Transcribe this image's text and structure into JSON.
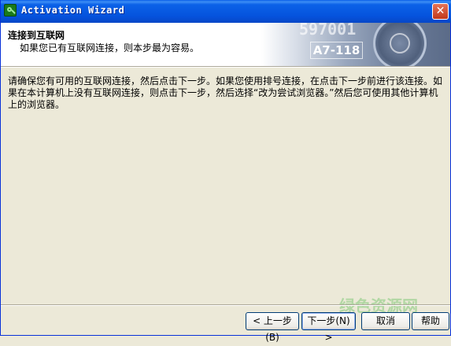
{
  "window": {
    "title": "Activation Wizard",
    "close_glyph": "✕",
    "app_icon": "activation-key-icon"
  },
  "header": {
    "title": "连接到互联网",
    "subtitle": "如果您已有互联网连接，则本步最为容易。",
    "banner_code_1": "597001",
    "banner_code_2": "A7-118"
  },
  "body": {
    "paragraph": "请确保您有可用的互联网连接，然后点击下一步。如果您使用排号连接，在点击下一步前进行该连接。如果在本计算机上没有互联网连接，则点击下一步，然后选择“改为尝试浏览器。”然后您可使用其他计算机上的浏览器。"
  },
  "buttons": {
    "back": "< 上一步(B)",
    "next": "下一步(N) >",
    "cancel": "取消",
    "help": "帮助"
  },
  "watermark": "绿色资源网",
  "colors": {
    "titlebar": "#0553DD",
    "face": "#ECE9D8",
    "button_border": "#003C74"
  }
}
